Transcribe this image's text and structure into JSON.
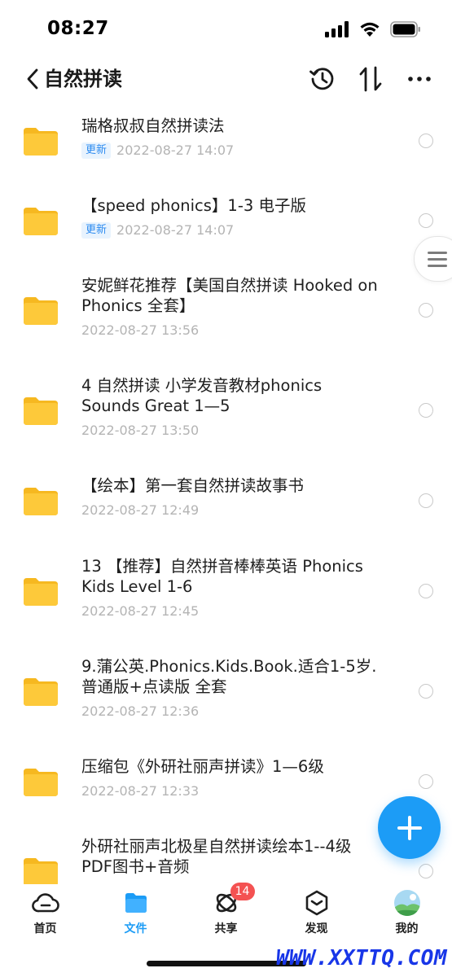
{
  "status": {
    "time": "08:27"
  },
  "header": {
    "title": "自然拼读"
  },
  "files": [
    {
      "name": "瑞格叔叔自然拼读法",
      "badge": "更新",
      "date": "2022-08-27 14:07"
    },
    {
      "name": "【speed phonics】1-3 电子版",
      "badge": "更新",
      "date": "2022-08-27 14:07"
    },
    {
      "name": "安妮鲜花推荐【美国自然拼读 Hooked on Phonics 全套】",
      "badge": "",
      "date": "2022-08-27 13:56"
    },
    {
      "name": "4  自然拼读 小学发音教材phonics Sounds Great 1—5",
      "badge": "",
      "date": "2022-08-27 13:50"
    },
    {
      "name": "【绘本】第一套自然拼读故事书",
      "badge": "",
      "date": "2022-08-27 12:49"
    },
    {
      "name": "13  【推荐】自然拼音棒棒英语 Phonics Kids Level 1-6",
      "badge": "",
      "date": "2022-08-27 12:45"
    },
    {
      "name": "9.蒲公英.Phonics.Kids.Book.适合1-5岁.普通版+点读版 全套",
      "badge": "",
      "date": "2022-08-27 12:36"
    },
    {
      "name": "压缩包《外研社丽声拼读》1—6级",
      "badge": "",
      "date": "2022-08-27 12:33"
    },
    {
      "name": "外研社丽声北极星自然拼读绘本1--4级 PDF图书+音频",
      "badge": "",
      "date": ""
    }
  ],
  "tabs": [
    {
      "label": "首页",
      "icon": "cloud-icon",
      "active": false
    },
    {
      "label": "文件",
      "icon": "folder-icon",
      "active": true
    },
    {
      "label": "共享",
      "icon": "orbit-icon",
      "active": false,
      "badge": "14"
    },
    {
      "label": "发现",
      "icon": "discover-icon",
      "active": false
    },
    {
      "label": "我的",
      "icon": "avatar-icon",
      "active": false
    }
  ],
  "watermark": "WWW.XXTTQ.COM",
  "colors": {
    "accent": "#1c9cf6",
    "folder": "#fdc93a",
    "badge": "#f45252"
  }
}
